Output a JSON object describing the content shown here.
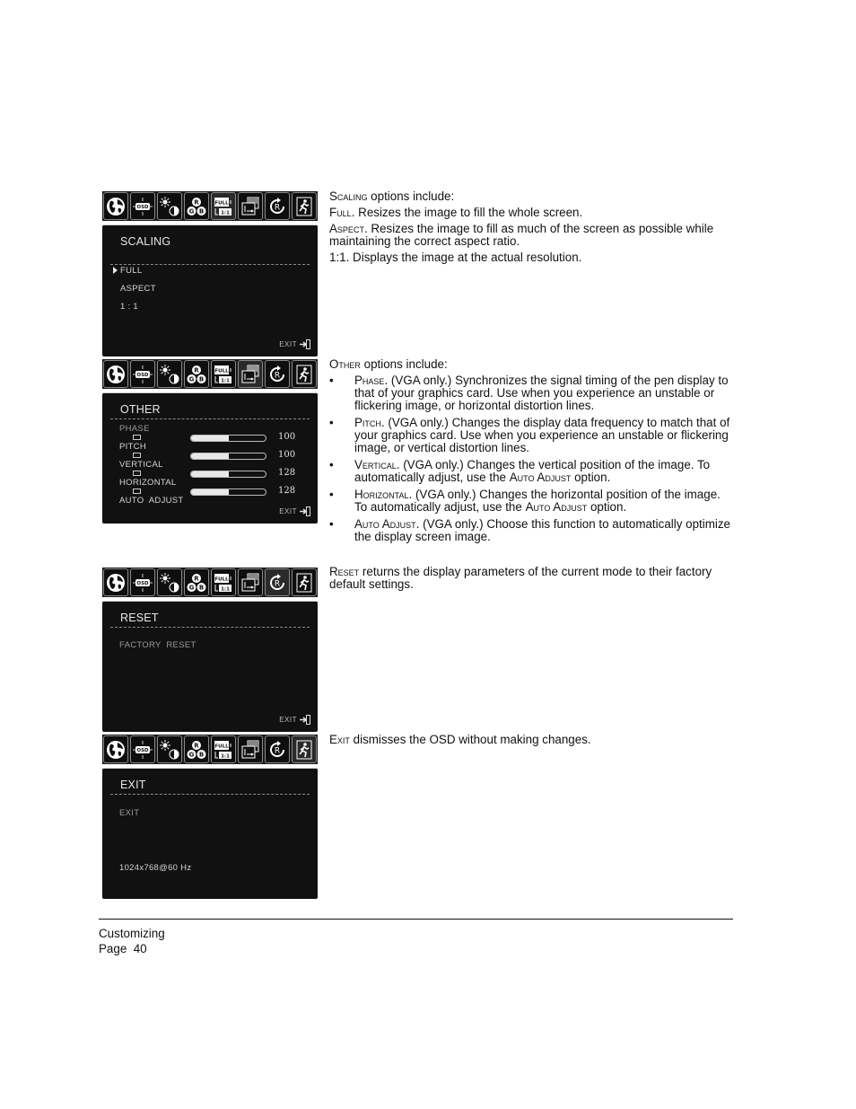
{
  "osd_icons": [
    {
      "name": "globe-language-icon"
    },
    {
      "name": "osd-position-icon",
      "label": "OSD"
    },
    {
      "name": "brightness-contrast-icon"
    },
    {
      "name": "rgb-color-icon",
      "labels": [
        "R",
        "G",
        "B"
      ]
    },
    {
      "name": "scaling-icon",
      "labels": [
        "FULL",
        "1:1"
      ]
    },
    {
      "name": "other-settings-icon"
    },
    {
      "name": "reset-icon",
      "label": "R"
    },
    {
      "name": "exit-running-man-icon"
    }
  ],
  "panels": {
    "scaling": {
      "title": "SCALING",
      "items": [
        "FULL",
        "ASPECT",
        "1 : 1"
      ],
      "selected": "FULL",
      "exit_label": "EXIT"
    },
    "other": {
      "title": "OTHER",
      "items": [
        {
          "label": "PHASE",
          "value": "100",
          "fill": 0.5
        },
        {
          "label": "PITCH",
          "value": "100",
          "fill": 0.5
        },
        {
          "label": "VERTICAL",
          "value": "128",
          "fill": 0.5
        },
        {
          "label": "HORIZONTAL",
          "value": "128",
          "fill": 0.5
        }
      ],
      "auto_adjust": "AUTO  ADJUST",
      "exit_label": "EXIT"
    },
    "reset": {
      "title": "RESET",
      "item": "FACTORY  RESET",
      "exit_label": "EXIT"
    },
    "exit": {
      "title": "EXIT",
      "item": "EXIT",
      "resolution": "1024x768@60 Hz"
    }
  },
  "text": {
    "scaling": {
      "intro_term": "Scaling",
      "intro_rest": " options include:",
      "full_term": "Full",
      "full_rest": ".  Resizes the image to fill the whole screen.",
      "aspect_term": "Aspect",
      "aspect_rest": ".  Resizes the image to fill as much of the screen as possible while maintaining the correct aspect ratio.",
      "one_one": "1:1.  Displays the image at the actual resolution."
    },
    "other": {
      "intro_term": "Other",
      "intro_rest": " options include:",
      "bullet": "•",
      "bullets": [
        {
          "term": "Phase",
          "rest": ".  (VGA only.)  Synchronizes the signal timing of the pen display to that of your graphics card.  Use when you experience an unstable or flickering image, or horizontal distortion lines."
        },
        {
          "term": "Pitch",
          "rest": ".  (VGA only.)  Changes the display data frequency to match that of your graphics card.  Use when you experience an unstable or flickering image, or vertical distortion lines."
        },
        {
          "term": "Vertical",
          "rest": ".  (VGA only.)  Changes the vertical position of the image. To automatically adjust, use the ",
          "term2": "Auto Adjust",
          "rest2": " option."
        },
        {
          "term": "Horizontal",
          "rest": ".  (VGA only.)  Changes the horizontal position of the image.  To automatically adjust, use the ",
          "term2": "Auto Adjust",
          "rest2": " option."
        },
        {
          "term": "Auto Adjust",
          "rest": ".  (VGA only.)  Choose this function to automatically optimize the display screen image."
        }
      ]
    },
    "reset": {
      "term": "Reset",
      "rest": " returns the display parameters of the current mode to their factory default settings."
    },
    "exit": {
      "term": "Exit",
      "rest": " dismisses the OSD without making changes."
    }
  },
  "footer": {
    "section": "Customizing",
    "page": "Page  40"
  }
}
